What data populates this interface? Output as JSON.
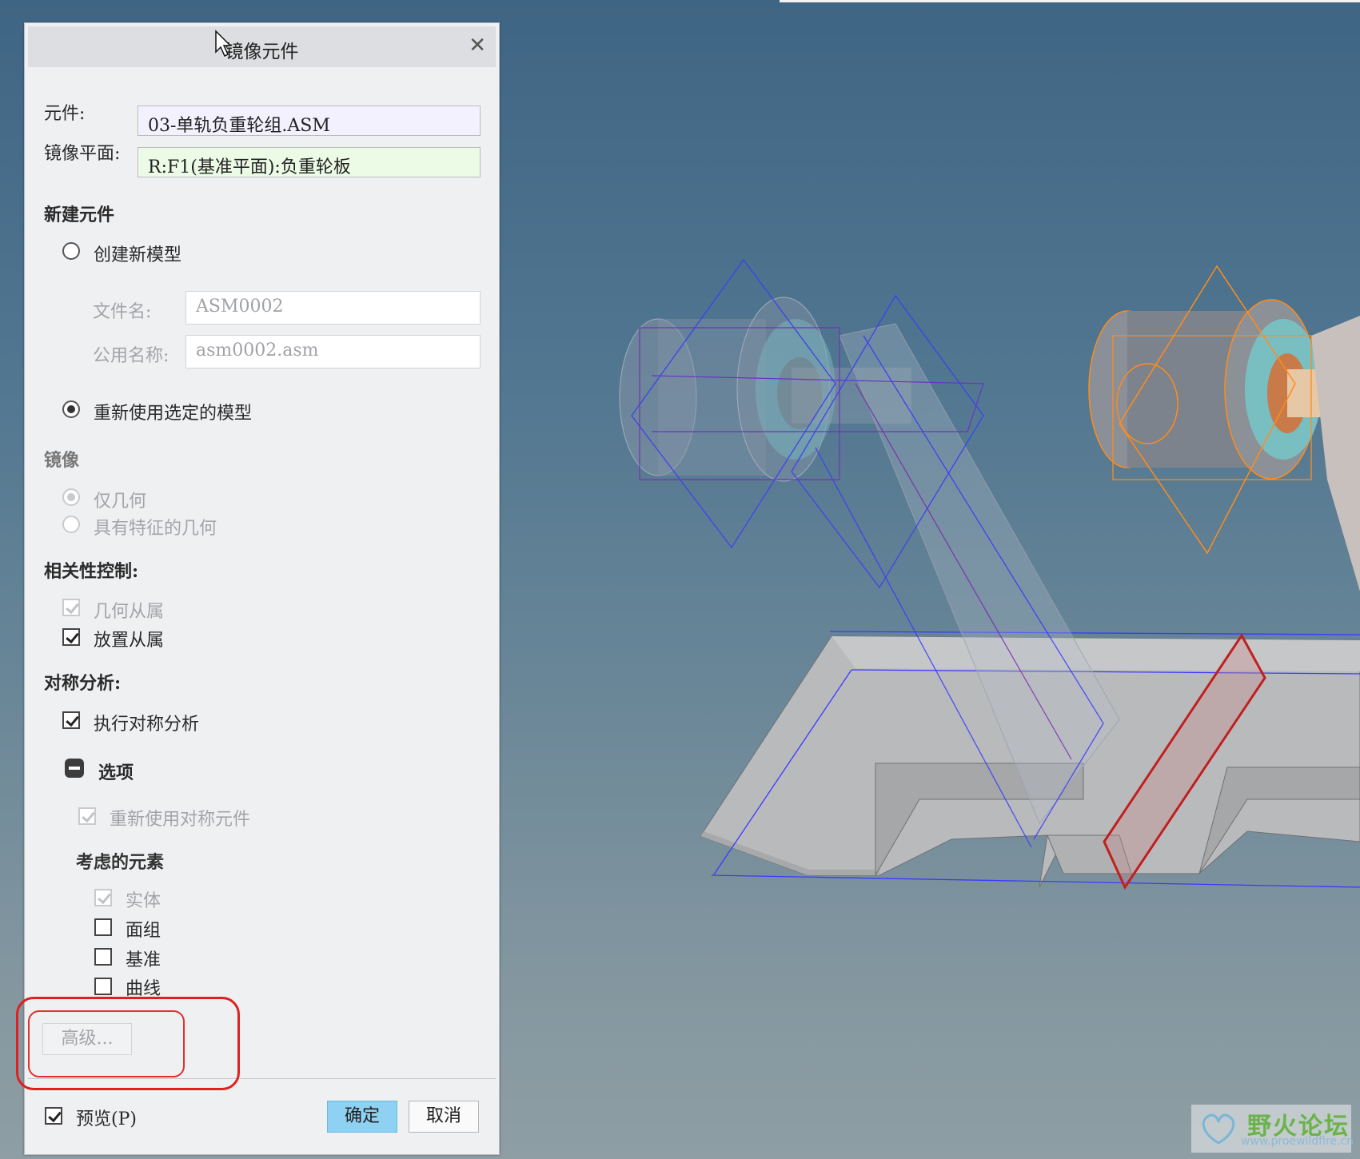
{
  "dialog": {
    "title": "镜像元件",
    "component_label": "元件:",
    "component_value": "03-单轨负重轮组.ASM",
    "mirror_plane_label": "镜像平面:",
    "mirror_plane_value": "R:F1(基准平面):负重轮板",
    "new_component": {
      "heading": "新建元件",
      "create_new_model": "创建新模型",
      "file_name_label": "文件名:",
      "file_name_value": "ASM0002",
      "common_name_label": "公用名称:",
      "common_name_value": "asm0002.asm",
      "reuse_selected": "重新使用选定的模型"
    },
    "mirror": {
      "heading": "镜像",
      "geometry_only": "仅几何",
      "geometry_with_features": "具有特征的几何"
    },
    "dependency": {
      "heading": "相关性控制:",
      "geometry_dependent": "几何从属",
      "placement_dependent": "放置从属"
    },
    "symmetry": {
      "heading": "对称分析:",
      "perform": "执行对称分析",
      "options_heading": "选项",
      "reuse_symmetric": "重新使用对称元件",
      "elements_heading": "考虑的元素",
      "solid": "实体",
      "quilts": "面组",
      "datums": "基准",
      "curves": "曲线"
    },
    "advanced_button": "高级...",
    "preview_label": "预览(P)",
    "ok_button": "确定",
    "cancel_button": "取消"
  },
  "watermark": {
    "title": "野火论坛",
    "url": "www.proewildfire.cn"
  },
  "colors": {
    "primary_button": "#8ed1f2",
    "highlight_red": "#e02020",
    "selection_orange": "#ff8c1a",
    "preview_blue": "#3a3aff"
  }
}
